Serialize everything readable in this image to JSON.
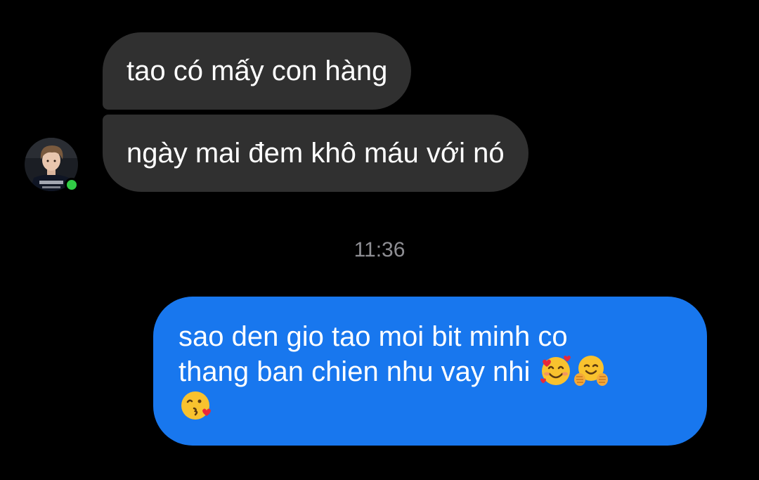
{
  "conversation": {
    "incoming_messages": [
      {
        "text": "tao có mấy con hàng"
      },
      {
        "text": "ngày mai đem khô máu với nó"
      }
    ],
    "timestamp": "11:36",
    "outgoing_message": {
      "lines": [
        "sao den gio tao moi bit minh co",
        "thang ban chien nhu vay nhi"
      ],
      "emojis": [
        "smiling-face-with-hearts",
        "hugging-face",
        "face-blowing-a-kiss"
      ]
    }
  },
  "contact": {
    "avatar_icon": "user-avatar-photo",
    "online_status": "online",
    "online_color": "#31cc46"
  },
  "colors": {
    "incoming_bubble": "#303030",
    "outgoing_bubble": "#1877ee",
    "background": "#000000"
  }
}
